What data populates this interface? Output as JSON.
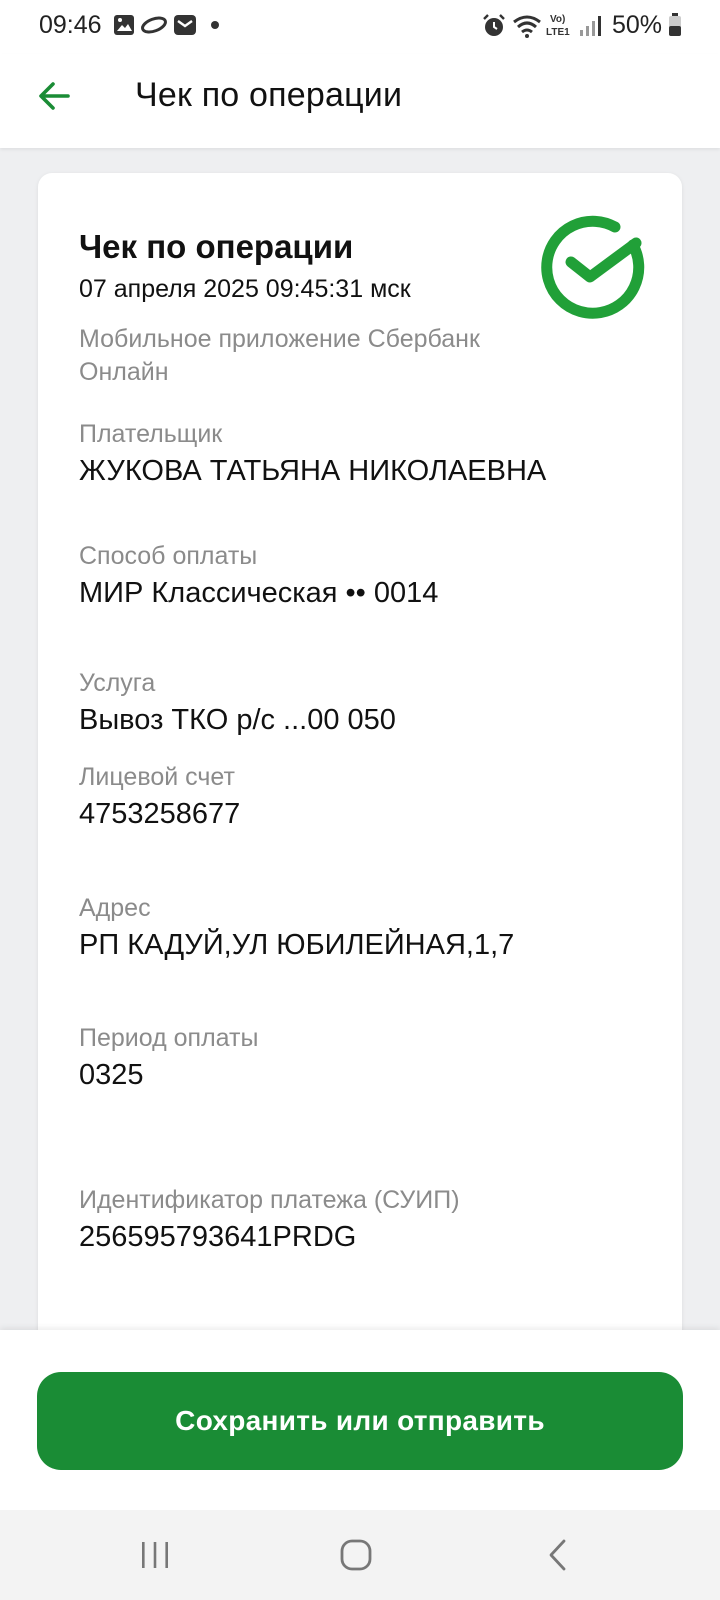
{
  "status_bar": {
    "time": "09:46",
    "battery": "50%",
    "icons": [
      "image-icon",
      "cloud-icon",
      "mail-icon",
      "dot-icon",
      "alarm-icon",
      "wifi-icon",
      "volte-icon",
      "signal-icon",
      "battery-icon"
    ]
  },
  "header": {
    "title": "Чек по операции",
    "back_icon": "arrow-left-icon"
  },
  "receipt": {
    "title": "Чек по операции",
    "datetime": "07 апреля 2025 09:45:31 мск",
    "source": "Мобильное приложение Сбербанк Онлайн",
    "status_icon": "success-check-icon",
    "fields": [
      {
        "label": "Плательщик",
        "value": "ЖУКОВА ТАТЬЯНА НИКОЛАЕВНА"
      },
      {
        "label": "Способ оплаты",
        "value": "МИР Классическая •• 0014"
      },
      {
        "label": "Услуга",
        "value": "Вывоз ТКО р/с ...00 050"
      },
      {
        "label": "Лицевой счет",
        "value": "4753258677"
      },
      {
        "label": "Адрес",
        "value": "РП КАДУЙ,УЛ ЮБИЛЕЙНАЯ,1,7"
      },
      {
        "label": "Период оплаты",
        "value": "0325"
      },
      {
        "label": "Идентификатор платежа (СУИП)",
        "value": "256595793641PRDG"
      }
    ]
  },
  "actions": {
    "save_label": "Сохранить или отправить"
  },
  "colors": {
    "brand_green": "#1a8c35",
    "label_gray": "#8b8b8b",
    "background": "#eeeff1"
  },
  "nav": {
    "icons": [
      "recent-apps-icon",
      "home-icon",
      "back-icon"
    ]
  }
}
